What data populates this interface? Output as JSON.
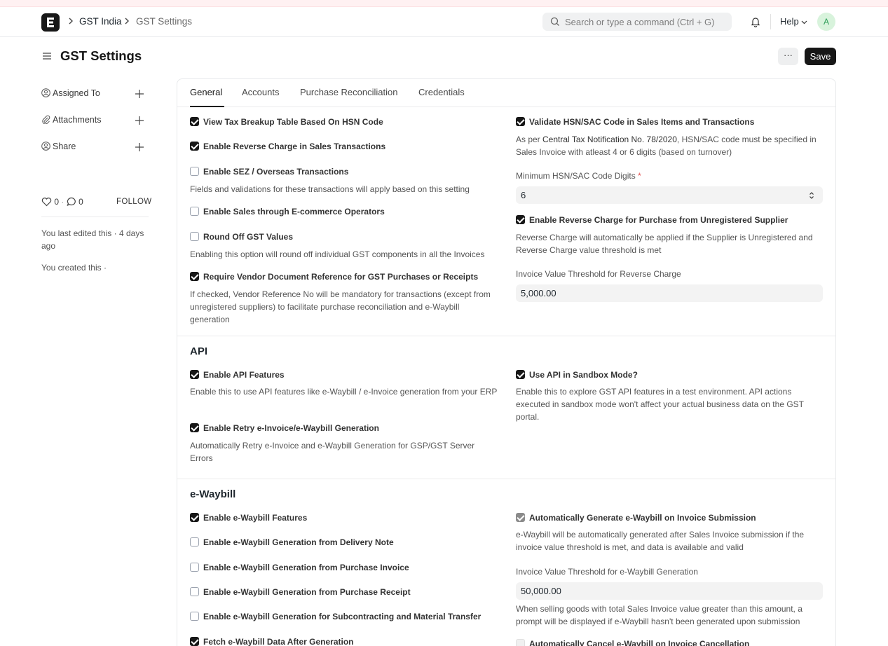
{
  "breadcrumb": [
    "GST India",
    "GST Settings"
  ],
  "search": {
    "placeholder": "Search or type a command (Ctrl + G)"
  },
  "navbar": {
    "help": "Help",
    "avatar": "A"
  },
  "page": {
    "title": "GST Settings",
    "more": "···",
    "save": "Save"
  },
  "sidebar": {
    "items": [
      "Assigned To",
      "Attachments",
      "Share"
    ],
    "likes": "0",
    "comments": "0",
    "follow": "FOLLOW",
    "edited": "You last edited this · 4 days ago",
    "created": "You created this ·"
  },
  "tabs": [
    "General",
    "Accounts",
    "Purchase Reconciliation",
    "Credentials"
  ],
  "general": {
    "left": [
      {
        "label": "View Tax Breakup Table Based On HSN Code",
        "checked": true
      },
      {
        "label": "Enable Reverse Charge in Sales Transactions",
        "checked": true
      },
      {
        "label": "Enable SEZ / Overseas Transactions",
        "checked": false,
        "desc": "Fields and validations for these transactions will apply based on this setting"
      },
      {
        "label": "Enable Sales through E-commerce Operators",
        "checked": false
      },
      {
        "label": "Round Off GST Values",
        "checked": false,
        "desc": "Enabling this option will round off individual GST components in all the Invoices"
      },
      {
        "label": "Require Vendor Document Reference for GST Purchases or Receipts",
        "checked": true,
        "desc": "If checked, Vendor Reference No will be mandatory for transactions (except from unregistered suppliers) to facilitate purchase reconciliation and e-Waybill generation"
      }
    ],
    "validate_hsn": {
      "label": "Validate HSN/SAC Code in Sales Items and Transactions",
      "checked": true,
      "desc_pre": "As per ",
      "desc_link": "Central Tax Notification No. 78/2020",
      "desc_post": ", HSN/SAC code must be specified in Sales Invoice with atleast 4 or 6 digits (based on turnover)"
    },
    "min_digits": {
      "label": "Minimum HSN/SAC Code Digits",
      "required": "*",
      "value": "6"
    },
    "rc_purchase": {
      "label": "Enable Reverse Charge for Purchase from Unregistered Supplier",
      "checked": true,
      "desc": "Reverse Charge will automatically be applied if the Supplier is Unregistered and Reverse Charge value threshold is met"
    },
    "rc_threshold": {
      "label": "Invoice Value Threshold for Reverse Charge",
      "value": "5,000.00"
    }
  },
  "api": {
    "title": "API",
    "enable": {
      "label": "Enable API Features",
      "checked": true,
      "desc": "Enable this to use API features like e-Waybill / e-Invoice generation from your ERP"
    },
    "retry": {
      "label": "Enable Retry e-Invoice/e-Waybill Generation",
      "checked": true,
      "desc": "Automatically Retry e-Invoice and e-Waybill Generation for GSP/GST Server Errors"
    },
    "sandbox": {
      "label": "Use API in Sandbox Mode?",
      "checked": true,
      "desc": "Enable this to explore GST API features in a test environment. API actions executed in sandbox mode won't affect your actual business data on the GST portal."
    }
  },
  "ewaybill": {
    "title": "e-Waybill",
    "left": [
      {
        "label": "Enable e-Waybill Features",
        "checked": true
      },
      {
        "label": "Enable e-Waybill Generation from Delivery Note",
        "checked": false
      },
      {
        "label": "Enable e-Waybill Generation from Purchase Invoice",
        "checked": false
      },
      {
        "label": "Enable e-Waybill Generation from Purchase Receipt",
        "checked": false
      },
      {
        "label": "Enable e-Waybill Generation for Subcontracting and Material Transfer",
        "checked": false
      },
      {
        "label": "Fetch e-Waybill Data After Generation",
        "checked": true
      }
    ],
    "auto_generate": {
      "label": "Automatically Generate e-Waybill on Invoice Submission",
      "checked": true,
      "desc": "e-Waybill will be automatically generated after Sales Invoice submission if the invoice value threshold is met, and data is available and valid"
    },
    "threshold": {
      "label": "Invoice Value Threshold for e-Waybill Generation",
      "value": "50,000.00",
      "desc": "When selling goods with total Sales Invoice value greater than this amount, a prompt will be displayed if e-Waybill hasn't been generated upon submission"
    },
    "auto_cancel": {
      "label": "Automatically Cancel e-Waybill on Invoice Cancellation",
      "checked": false
    }
  }
}
